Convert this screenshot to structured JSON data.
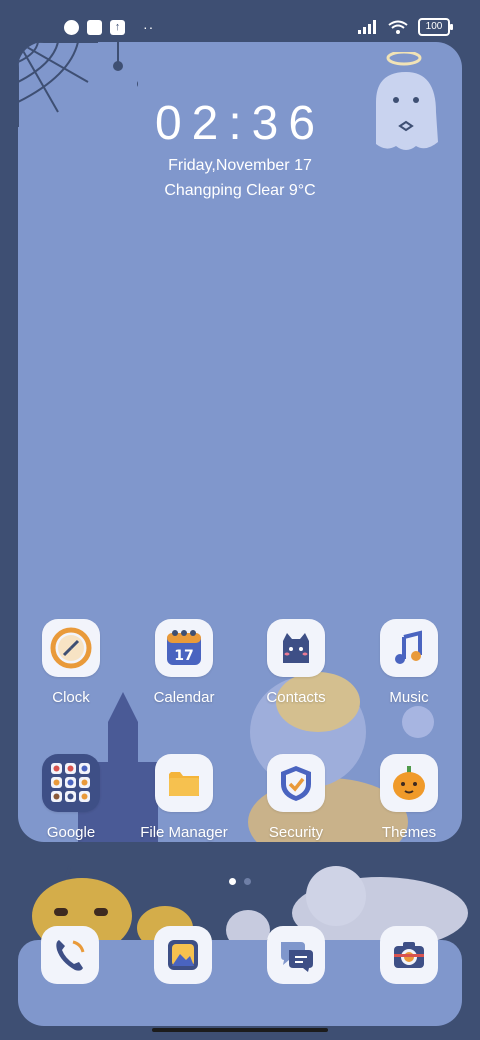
{
  "status_bar": {
    "battery": "100",
    "upload_glyph": "↑",
    "overflow_dots": "··",
    "icons": [
      "notification-icon",
      "app-icon",
      "upload-icon",
      "signal-icon",
      "wifi-icon",
      "battery-icon"
    ]
  },
  "lockscreen": {
    "time": "02:36",
    "date": "Friday,November 17",
    "weather": "Changping Clear 9°C"
  },
  "apps": [
    {
      "label": "Clock",
      "icon": "clock-icon"
    },
    {
      "label": "Calendar",
      "icon": "calendar-icon",
      "badge": "17"
    },
    {
      "label": "Contacts",
      "icon": "contacts-cat-icon"
    },
    {
      "label": "Music",
      "icon": "music-icon"
    },
    {
      "label": "Google",
      "icon": "google-folder-icon"
    },
    {
      "label": "File Manager",
      "icon": "folder-icon"
    },
    {
      "label": "Security",
      "icon": "shield-icon"
    },
    {
      "label": "Themes",
      "icon": "pumpkin-icon"
    }
  ],
  "dock": [
    {
      "icon": "phone-icon"
    },
    {
      "icon": "gallery-icon"
    },
    {
      "icon": "messages-icon"
    },
    {
      "icon": "camera-icon"
    }
  ],
  "pages": {
    "count": 2,
    "active": 1
  },
  "colors": {
    "background": "#3e4f73",
    "wallpaper": "#8097cc",
    "icon_bg": "#f2f4fb",
    "accent_orange": "#e99a3a",
    "accent_navy": "#3d4f86"
  }
}
